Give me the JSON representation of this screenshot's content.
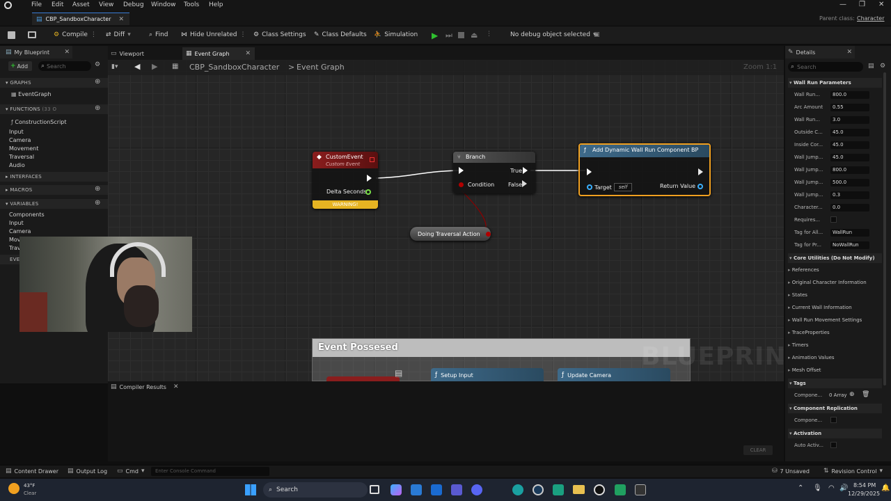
{
  "menu": [
    "File",
    "Edit",
    "Asset",
    "View",
    "Debug",
    "Window",
    "Tools",
    "Help"
  ],
  "doc_tab": "CBP_SandboxCharacter",
  "parent_class_label": "Parent class:",
  "parent_class_value": "Character",
  "toolbar": {
    "compile": "Compile",
    "diff": "Diff",
    "find": "Find",
    "hide_unrelated": "Hide Unrelated",
    "class_settings": "Class Settings",
    "class_defaults": "Class Defaults",
    "simulation": "Simulation",
    "debug_object": "No debug object selected"
  },
  "left": {
    "tab": "My Blueprint",
    "add": "Add",
    "search_placeholder": "Search",
    "graphs": "GRAPHS",
    "event_graph": "EventGraph",
    "functions": "FUNCTIONS",
    "functions_count": "(33 O",
    "construction_script": "ConstructionScript",
    "func_cats": [
      "Input",
      "Camera",
      "Movement",
      "Traversal",
      "Audio"
    ],
    "interfaces": "INTERFACES",
    "macros": "MACROS",
    "variables": "VARIABLES",
    "var_cats": [
      "Components",
      "Input",
      "Camera",
      "Mov",
      "Trav"
    ],
    "dispatchers": "EVE"
  },
  "graph": {
    "tab_viewport": "Viewport",
    "tab_event_graph": "Event Graph",
    "breadcrumb_root": "CBP_SandboxCharacter",
    "breadcrumb_current": "Event Graph",
    "zoom": "Zoom 1:1",
    "watermark": "BLUEPRINT",
    "custom_event": {
      "title": "CustomEvent",
      "subtitle": "Custom Event",
      "pin": "Delta Seconds",
      "warning": "WARNING!"
    },
    "branch": {
      "title": "Branch",
      "true": "True",
      "condition": "Condition",
      "false": "False"
    },
    "add_node": {
      "title": "Add Dynamic Wall Run Component BP",
      "target": "Target",
      "self": "self",
      "return": "Return Value"
    },
    "traversal": "Doing Traversal Action",
    "comment": "Event Possesed",
    "setup_input": "Setup Input",
    "update_camera": "Update Camera"
  },
  "compiler": {
    "tab": "Compiler Results",
    "clear": "CLEAR"
  },
  "details": {
    "tab": "Details",
    "search_placeholder": "Search",
    "section1": "Wall Run Parameters",
    "props": [
      {
        "label": "Wall Run...",
        "value": "800.0"
      },
      {
        "label": "Arc Amount",
        "value": "0.55"
      },
      {
        "label": "Wall Run...",
        "value": "3.0"
      },
      {
        "label": "Outside C...",
        "value": "45.0"
      },
      {
        "label": "Inside Cor...",
        "value": "45.0"
      },
      {
        "label": "Wall Jump...",
        "value": "45.0"
      },
      {
        "label": "Wall Jump...",
        "value": "800.0"
      },
      {
        "label": "Wall Jump...",
        "value": "500.0"
      },
      {
        "label": "Wall Jump...",
        "value": "0.3"
      },
      {
        "label": "Character...",
        "value": "0.0"
      }
    ],
    "requires": "Requires...",
    "tag_all_label": "Tag for All...",
    "tag_all_value": "WallRun",
    "tag_pr_label": "Tag for Pr...",
    "tag_pr_value": "NoWallRun",
    "section2": "Core Utilities (Do Not Modify)",
    "cats": [
      "References",
      "Original Character Information",
      "States",
      "Current Wall Information",
      "Wall Run Movement Settings",
      "TraceProperties",
      "Timers",
      "Animation Values",
      "Mesh Offset"
    ],
    "tags_section": "Tags",
    "tags_label": "Compone...",
    "tags_value": "0 Array",
    "replication_section": "Component Replication",
    "replication_label": "Compone...",
    "activation_section": "Activation",
    "activation_label": "Auto Activ..."
  },
  "status": {
    "content_drawer": "Content Drawer",
    "output_log": "Output Log",
    "cmd": "Cmd",
    "console_placeholder": "Enter Console Command",
    "unsaved": "7 Unsaved",
    "revision": "Revision Control"
  },
  "taskbar": {
    "temp": "43°F",
    "weather": "Clear",
    "search": "Search",
    "time": "8:54 PM",
    "date": "12/29/2025"
  },
  "colors": {
    "event_red": "#8a1d1d",
    "warning": "#e6b422",
    "selected": "#f0a020",
    "func_blue": "#3e6a8a",
    "exec": "#ffffff",
    "bool_pin": "#8c0000",
    "obj_pin": "#3ab0ff"
  }
}
